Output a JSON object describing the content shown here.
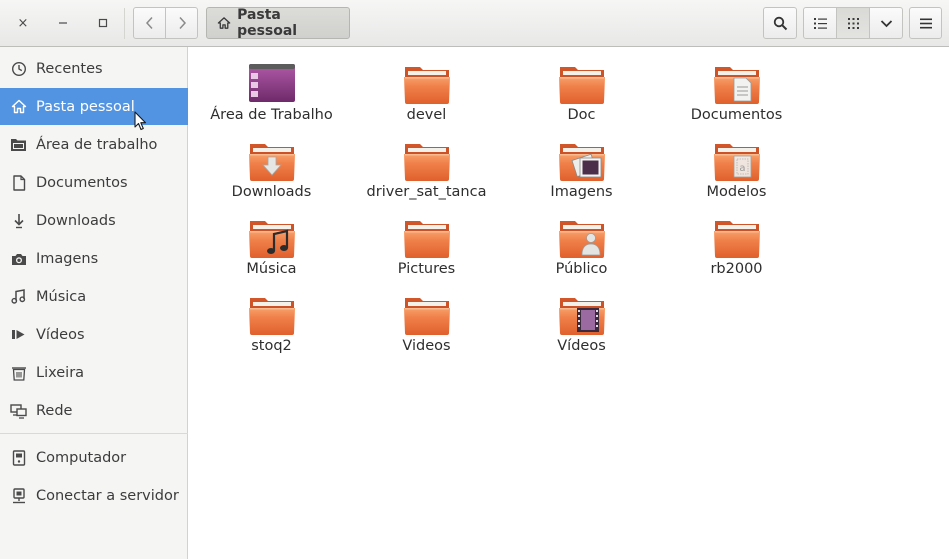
{
  "window": {
    "close_glyph": "×",
    "minimize_glyph": "—",
    "maximize_glyph": "□"
  },
  "header": {
    "back_icon": "chevron-left-icon",
    "forward_icon": "chevron-right-icon",
    "path_label": "Pasta pessoal",
    "path_icon": "home-icon",
    "search_icon": "search-icon",
    "list_view_icon": "list-view-icon",
    "grid_view_icon": "grid-view-icon",
    "view_options_icon": "chevron-down-icon",
    "menu_icon": "hamburger-menu-icon"
  },
  "sidebar": {
    "items": [
      {
        "label": "Recentes",
        "icon": "clock-icon"
      },
      {
        "label": "Pasta pessoal",
        "icon": "home-icon",
        "active": true
      },
      {
        "label": "Área de trabalho",
        "icon": "desktop-folder-icon"
      },
      {
        "label": "Documentos",
        "icon": "document-icon"
      },
      {
        "label": "Downloads",
        "icon": "download-icon"
      },
      {
        "label": "Imagens",
        "icon": "camera-icon"
      },
      {
        "label": "Música",
        "icon": "music-icon"
      },
      {
        "label": "Vídeos",
        "icon": "video-icon"
      },
      {
        "label": "Lixeira",
        "icon": "trash-icon"
      },
      {
        "label": "Rede",
        "icon": "network-icon"
      }
    ],
    "devices": [
      {
        "label": "Computador",
        "icon": "computer-icon"
      },
      {
        "label": "Conectar a servidor",
        "icon": "server-icon"
      }
    ]
  },
  "files": [
    {
      "name": "Área de Trabalho",
      "icon": "desktop-icon"
    },
    {
      "name": "devel",
      "icon": "folder-icon"
    },
    {
      "name": "Doc",
      "icon": "folder-icon"
    },
    {
      "name": "Documentos",
      "icon": "folder-documents-icon"
    },
    {
      "name": "Downloads",
      "icon": "folder-download-icon"
    },
    {
      "name": "driver_sat_tanca",
      "icon": "folder-icon"
    },
    {
      "name": "Imagens",
      "icon": "folder-pictures-icon"
    },
    {
      "name": "Modelos",
      "icon": "folder-templates-icon"
    },
    {
      "name": "Música",
      "icon": "folder-music-icon"
    },
    {
      "name": "Pictures",
      "icon": "folder-icon"
    },
    {
      "name": "Público",
      "icon": "folder-public-icon"
    },
    {
      "name": "rb2000",
      "icon": "folder-icon"
    },
    {
      "name": "stoq2",
      "icon": "folder-icon"
    },
    {
      "name": "Videos",
      "icon": "folder-icon"
    },
    {
      "name": "Vídeos",
      "icon": "folder-videos-icon"
    }
  ],
  "colors": {
    "accent": "#5294e2",
    "folder_orange": "#e8703a",
    "desktop_purple": "#8e3a8c"
  }
}
